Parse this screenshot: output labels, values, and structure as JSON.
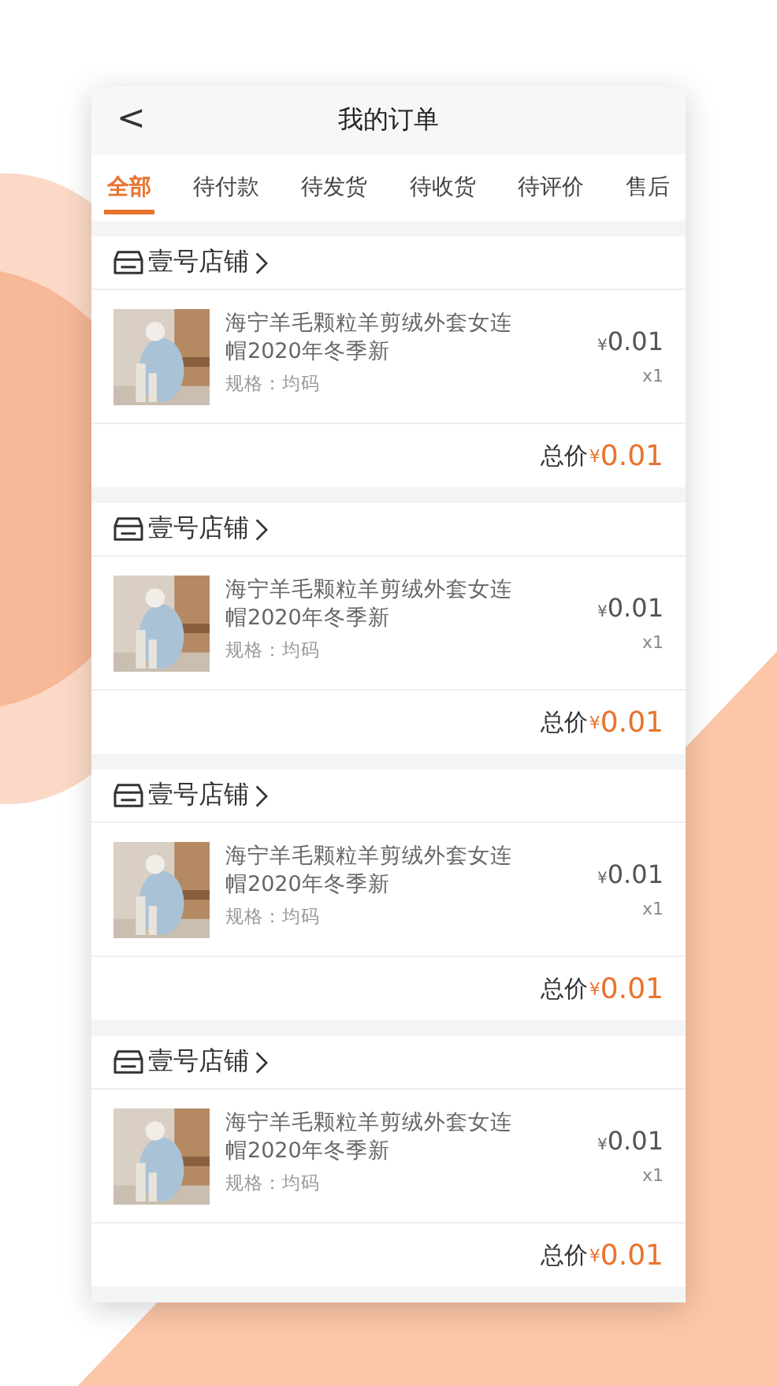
{
  "header": {
    "back": "<",
    "title": "我的订单"
  },
  "tabs": [
    {
      "label": "全部",
      "selected": true
    },
    {
      "label": "待付款",
      "selected": false
    },
    {
      "label": "待发货",
      "selected": false
    },
    {
      "label": "待收货",
      "selected": false
    },
    {
      "label": "待评价",
      "selected": false
    },
    {
      "label": "售后",
      "selected": false
    }
  ],
  "orders": [
    {
      "store": "壹号店铺",
      "product": {
        "kind": "picture",
        "name": "海宁羊毛颗粒羊剪绒外套女连帽2020年冬季新",
        "spec": "规格：均码",
        "currency": "¥",
        "price": "0.01",
        "qty": "x1"
      },
      "total_label": "总价",
      "total_currency": "¥",
      "total": "0.01"
    },
    {
      "store": "壹号店铺",
      "product": {
        "kind": "picture",
        "name": "海宁羊毛颗粒羊剪绒外套女连帽2020年冬季新",
        "spec": "规格：均码",
        "currency": "¥",
        "price": "0.01",
        "qty": "x1"
      },
      "total_label": "总价",
      "total_currency": "¥",
      "total": "0.01"
    },
    {
      "store": "壹号店铺",
      "product": {
        "kind": "picture",
        "name": "海宁羊毛颗粒羊剪绒外套女连帽2020年冬季新",
        "spec": "规格：均码",
        "currency": "¥",
        "price": "0.01",
        "qty": "x1"
      },
      "total_label": "总价",
      "total_currency": "¥",
      "total": "0.01"
    },
    {
      "store": "壹号店铺",
      "product": {
        "kind": "picture",
        "name": "海宁羊毛颗粒羊剪绒外套女连帽2020年冬季新",
        "spec": "规格：均码",
        "currency": "¥",
        "price": "0.01",
        "qty": "x1"
      },
      "total_label": "总价",
      "total_currency": "¥",
      "total": "0.01"
    }
  ]
}
